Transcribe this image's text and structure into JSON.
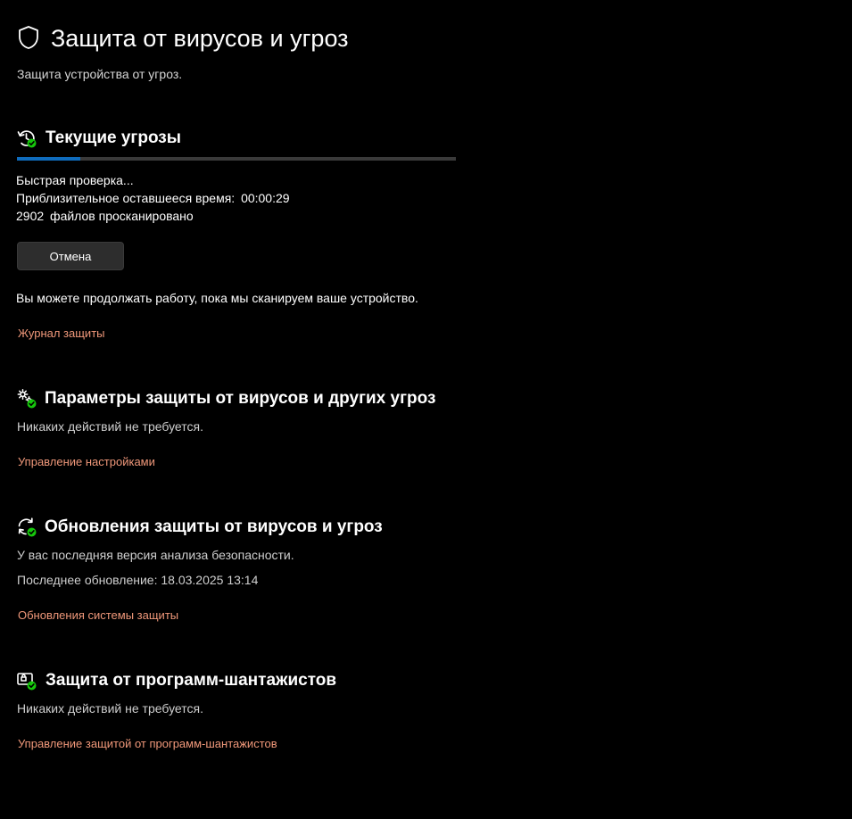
{
  "header": {
    "title": "Защита от вирусов и угроз",
    "subtitle": "Защита устройства от угроз.",
    "icon": "shield-icon"
  },
  "current_threats": {
    "title": "Текущие угрозы",
    "icon": "history-check-icon",
    "progress": 0.145,
    "progress_color": "#0f6cbd",
    "scan_status": "Быстрая проверка...",
    "time_label": "Приблизительное оставшееся время:",
    "time_value": "00:00:29",
    "files_count": "2902",
    "files_label": "файлов просканировано",
    "cancel_label": "Отмена",
    "info_text": "Вы можете продолжать работу, пока мы сканируем ваше устройство.",
    "history_link": "Журнал защиты"
  },
  "settings_section": {
    "title": "Параметры защиты от вирусов и других угроз",
    "icon": "gear-check-icon",
    "status": "Никаких действий не требуется.",
    "link": "Управление настройками"
  },
  "updates_section": {
    "title": "Обновления защиты от вирусов и угроз",
    "icon": "refresh-check-icon",
    "status": "У вас последняя версия анализа безопасности.",
    "last_update": "Последнее обновление: 18.03.2025 13:14",
    "link": "Обновления системы защиты"
  },
  "ransomware_section": {
    "title": "Защита от программ-шантажистов",
    "icon": "ransomware-check-icon",
    "status": "Никаких действий не требуется.",
    "link": "Управление защитой от программ-шантажистов"
  },
  "colors": {
    "background": "#000000",
    "link": "#f0987a",
    "status_ok": "#16c60c"
  }
}
